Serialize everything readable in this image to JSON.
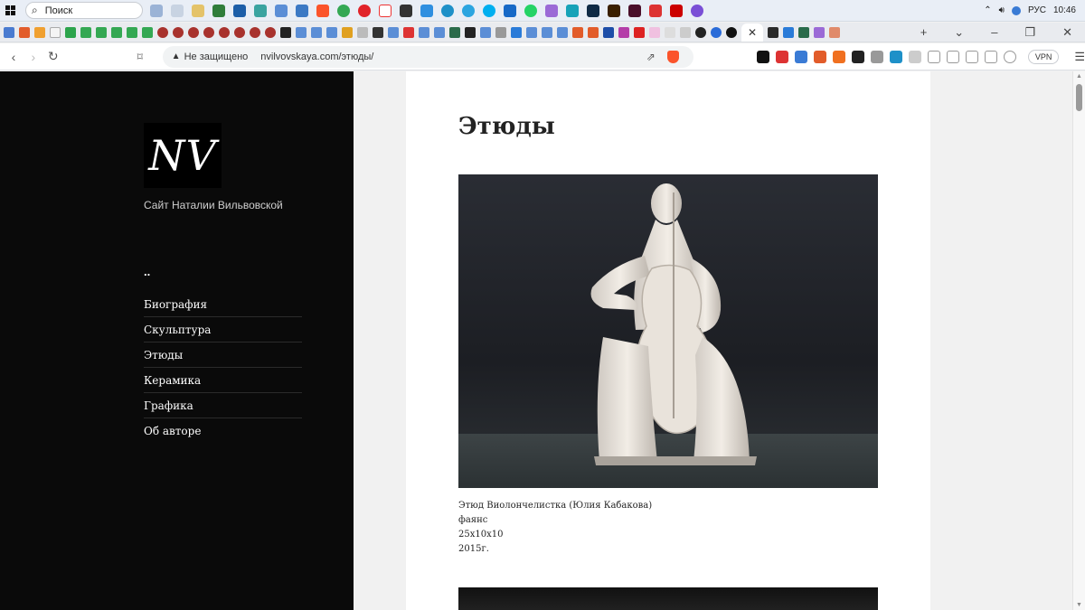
{
  "taskbar": {
    "search_placeholder": "Поиск",
    "language": "РУС",
    "clock": "10:46"
  },
  "browser": {
    "security_label": "Не защищено",
    "url": "nvilvovskaya.com/этюды/",
    "vpn_label": "VPN"
  },
  "sidebar": {
    "logo": "NV",
    "tagline": "Сайт Наталии Вильвовской",
    "parent_link": "..",
    "menu": [
      {
        "label": "Биография"
      },
      {
        "label": "Скульптура"
      },
      {
        "label": "Этюды"
      },
      {
        "label": "Керамика"
      },
      {
        "label": "Графика"
      },
      {
        "label": "Об авторе"
      }
    ]
  },
  "main": {
    "title": "Этюды",
    "items": [
      {
        "caption_lines": [
          "Этюд Виолончелистка (Юлия Кабакова)",
          "фаянс",
          "25х10х10",
          "2015г."
        ]
      }
    ]
  }
}
